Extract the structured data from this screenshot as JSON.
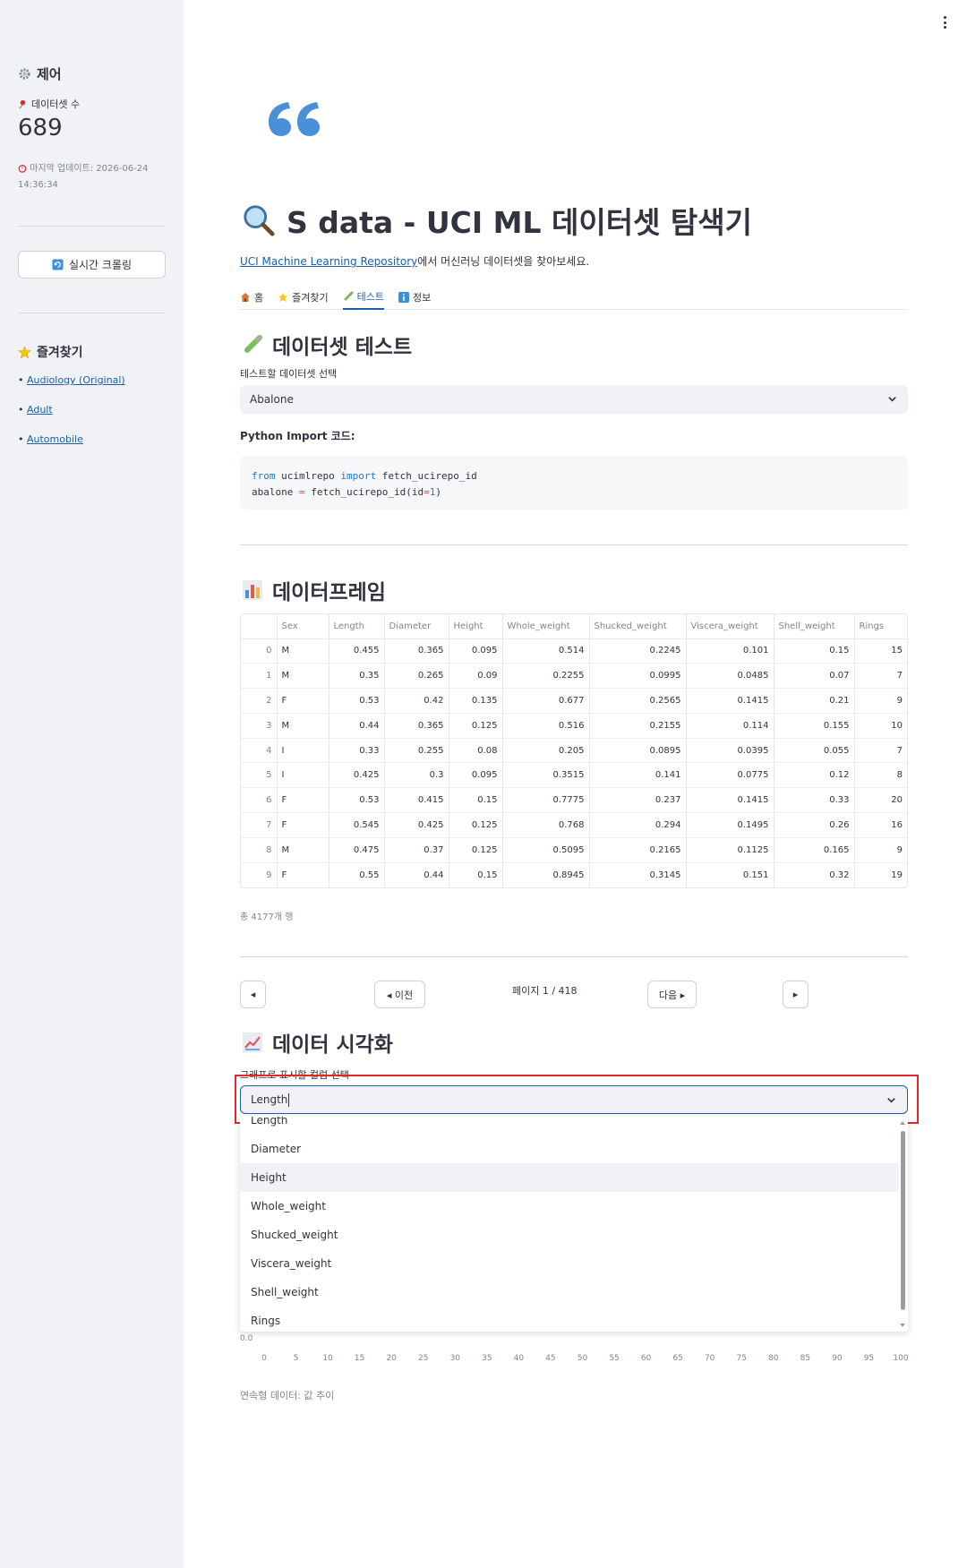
{
  "sidebar": {
    "header": "제어",
    "metric_label": "데이터셋 수",
    "metric_value": "689",
    "last_update": "마지막 업데이트: 2026-06-24 14:36:34",
    "crawl_button": "실시간 크롤링",
    "favorites_title": "즐겨찾기",
    "favorites": [
      "Audiology (Original)",
      "Adult",
      "Automobile"
    ]
  },
  "main": {
    "title": "S data - UCI ML 데이터셋 탐색기",
    "subtitle_link": "UCI Machine Learning Repository",
    "subtitle_rest": "에서 머신러닝 데이터셋을 찾아보세요.",
    "tabs": [
      {
        "label": "홈",
        "icon": "house-icon"
      },
      {
        "label": "즐겨찾기",
        "icon": "star-icon"
      },
      {
        "label": "테스트",
        "icon": "test-tube-icon",
        "active": true
      },
      {
        "label": "정보",
        "icon": "info-icon"
      }
    ],
    "test_heading": "데이터셋 테스트",
    "select_label": "테스트할 데이터셋 선택",
    "selected_dataset": "Abalone",
    "code_label": "Python Import 코드:",
    "code": {
      "line1": {
        "kw1": "from",
        "mod": " ucimlrepo ",
        "kw2": "import",
        "fn": " fetch_ucirepo_id"
      },
      "line2": {
        "var": "abalone ",
        "eq": "=",
        "call": " fetch_ucirepo_id(id",
        "eq2": "=",
        "num": "1",
        "close": ")"
      }
    },
    "df_heading": "데이터프레임",
    "table": {
      "columns": [
        "",
        "Sex",
        "Length",
        "Diameter",
        "Height",
        "Whole_weight",
        "Shucked_weight",
        "Viscera_weight",
        "Shell_weight",
        "Rings"
      ],
      "rows": [
        [
          "0",
          "M",
          "0.455",
          "0.365",
          "0.095",
          "0.514",
          "0.2245",
          "0.101",
          "0.15",
          "15"
        ],
        [
          "1",
          "M",
          "0.35",
          "0.265",
          "0.09",
          "0.2255",
          "0.0995",
          "0.0485",
          "0.07",
          "7"
        ],
        [
          "2",
          "F",
          "0.53",
          "0.42",
          "0.135",
          "0.677",
          "0.2565",
          "0.1415",
          "0.21",
          "9"
        ],
        [
          "3",
          "M",
          "0.44",
          "0.365",
          "0.125",
          "0.516",
          "0.2155",
          "0.114",
          "0.155",
          "10"
        ],
        [
          "4",
          "I",
          "0.33",
          "0.255",
          "0.08",
          "0.205",
          "0.0895",
          "0.0395",
          "0.055",
          "7"
        ],
        [
          "5",
          "I",
          "0.425",
          "0.3",
          "0.095",
          "0.3515",
          "0.141",
          "0.0775",
          "0.12",
          "8"
        ],
        [
          "6",
          "F",
          "0.53",
          "0.415",
          "0.15",
          "0.7775",
          "0.237",
          "0.1415",
          "0.33",
          "20"
        ],
        [
          "7",
          "F",
          "0.545",
          "0.425",
          "0.125",
          "0.768",
          "0.294",
          "0.1495",
          "0.26",
          "16"
        ],
        [
          "8",
          "M",
          "0.475",
          "0.37",
          "0.125",
          "0.5095",
          "0.2165",
          "0.1125",
          "0.165",
          "9"
        ],
        [
          "9",
          "F",
          "0.55",
          "0.44",
          "0.15",
          "0.8945",
          "0.3145",
          "0.151",
          "0.32",
          "19"
        ]
      ]
    },
    "row_count": "총 4177개 행",
    "pagination": {
      "first": "◂",
      "prev": "◂ 이전",
      "info": "페이지 1 / 418",
      "next": "다음 ▸",
      "last": "▸"
    },
    "viz_heading": "데이터 시각화",
    "viz_label": "그래프로 표시할 컬럼 선택",
    "viz_input": "Length",
    "dropdown_options": [
      "Length",
      "Diameter",
      "Height",
      "Whole_weight",
      "Shucked_weight",
      "Viscera_weight",
      "Shell_weight",
      "Rings"
    ],
    "dropdown_hovered": "Height",
    "chart_y_tick": "0.0",
    "chart_x_ticks": [
      "0",
      "5",
      "10",
      "15",
      "20",
      "25",
      "30",
      "35",
      "40",
      "45",
      "50",
      "55",
      "60",
      "65",
      "70",
      "75",
      "80",
      "85",
      "90",
      "95",
      "100"
    ],
    "viz_caption": "연속형 데이터: 값 추이"
  },
  "colors": {
    "link": "#1b5fa8",
    "sidebar_bg": "#f0f2f6",
    "highlight": "#e0282d"
  }
}
